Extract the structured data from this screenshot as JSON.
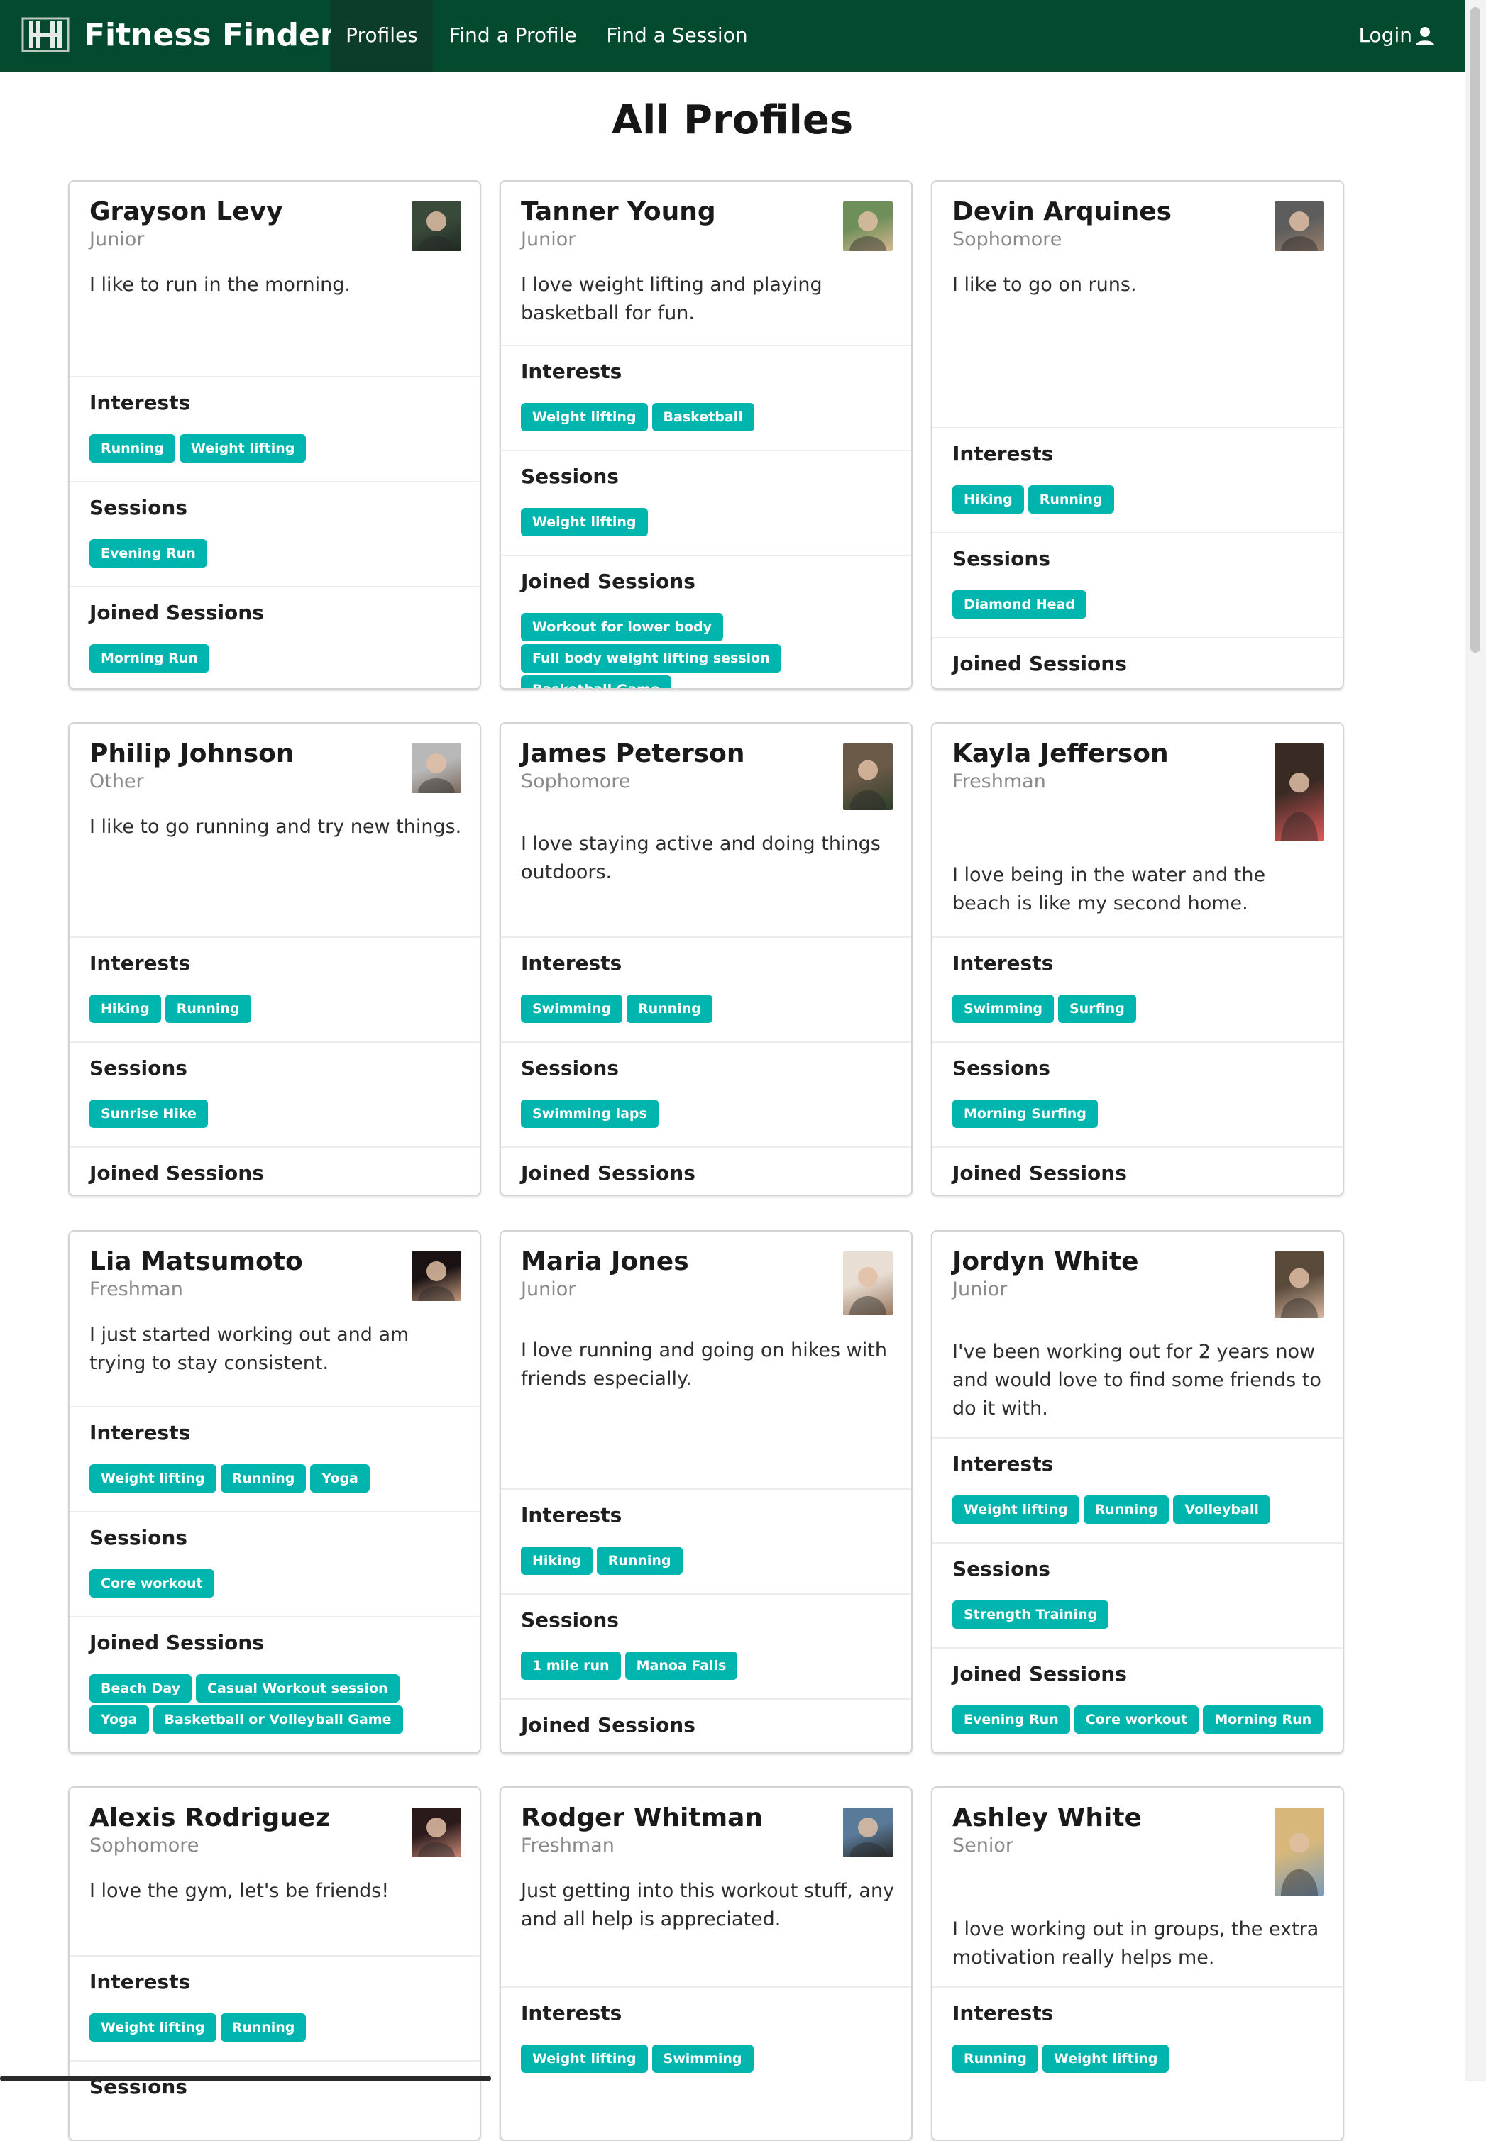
{
  "nav": {
    "brand": "Fitness Finder",
    "links": [
      "Profiles",
      "Find a Profile",
      "Find a Session"
    ],
    "login": "Login"
  },
  "page_title": "All Profiles",
  "section_titles": {
    "interests": "Interests",
    "sessions": "Sessions",
    "joined": "Joined Sessions"
  },
  "colors": {
    "navbar": "#034a2f",
    "tag": "#00b5ad"
  },
  "profiles": [
    {
      "name": "Grayson Levy",
      "standing": "Junior",
      "bio": "I like to run in the morning.",
      "interests": [
        "Running",
        "Weight lifting"
      ],
      "sessions": [
        "Evening Run"
      ],
      "joined": [
        "Morning Run"
      ]
    },
    {
      "name": "Tanner Young",
      "standing": "Junior",
      "bio": "I love weight lifting and playing basketball for fun.",
      "interests": [
        "Weight lifting",
        "Basketball"
      ],
      "sessions": [
        "Weight lifting"
      ],
      "joined": [
        "Workout for lower body",
        "Full body weight lifting session",
        "Basketball Game"
      ]
    },
    {
      "name": "Devin Arquines",
      "standing": "Sophomore",
      "bio": "I like to go on runs.",
      "interests": [
        "Hiking",
        "Running"
      ],
      "sessions": [
        "Diamond Head"
      ],
      "joined": []
    },
    {
      "name": "Philip Johnson",
      "standing": "Other",
      "bio": "I like to go running and try new things.",
      "interests": [
        "Hiking",
        "Running"
      ],
      "sessions": [
        "Sunrise Hike"
      ],
      "joined": []
    },
    {
      "name": "James Peterson",
      "standing": "Sophomore",
      "bio": "I love staying active and doing things outdoors.",
      "interests": [
        "Swimming",
        "Running"
      ],
      "sessions": [
        "Swimming laps"
      ],
      "joined": []
    },
    {
      "name": "Kayla Jefferson",
      "standing": "Freshman",
      "bio": "I love being in the water and the beach is like my second home.",
      "interests": [
        "Swimming",
        "Surfing"
      ],
      "sessions": [
        "Morning Surfing"
      ],
      "joined": []
    },
    {
      "name": "Lia Matsumoto",
      "standing": "Freshman",
      "bio": "I just started working out and am trying to stay consistent.",
      "interests": [
        "Weight lifting",
        "Running",
        "Yoga"
      ],
      "sessions": [
        "Core workout"
      ],
      "joined": [
        "Beach Day",
        "Casual Workout session",
        "Yoga",
        "Basketball or Volleyball Game"
      ]
    },
    {
      "name": "Maria Jones",
      "standing": "Junior",
      "bio": "I love running and going on hikes with friends especially.",
      "interests": [
        "Hiking",
        "Running"
      ],
      "sessions": [
        "1 mile run",
        "Manoa Falls"
      ],
      "joined": []
    },
    {
      "name": "Jordyn White",
      "standing": "Junior",
      "bio": "I've been working out for 2 years now and would love to find some friends to do it with.",
      "interests": [
        "Weight lifting",
        "Running",
        "Volleyball"
      ],
      "sessions": [
        "Strength Training"
      ],
      "joined": [
        "Evening Run",
        "Core workout",
        "Morning Run"
      ]
    },
    {
      "name": "Alexis Rodriguez",
      "standing": "Sophomore",
      "bio": "I love the gym, let's be friends!",
      "interests": [
        "Weight lifting",
        "Running"
      ],
      "sessions": [],
      "joined": []
    },
    {
      "name": "Rodger Whitman",
      "standing": "Freshman",
      "bio": "Just getting into this workout stuff, any and all help is appreciated.",
      "interests": [
        "Weight lifting",
        "Swimming"
      ],
      "sessions": [],
      "joined": []
    },
    {
      "name": "Ashley White",
      "standing": "Senior",
      "bio": "I love working out in groups, the extra motivation really helps me.",
      "interests": [
        "Running",
        "Weight lifting"
      ],
      "sessions": [],
      "joined": []
    }
  ]
}
